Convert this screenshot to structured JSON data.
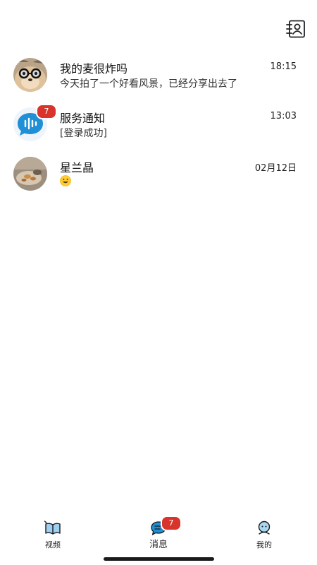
{
  "header": {
    "contacts_icon": "contacts-book-icon"
  },
  "conversations": [
    {
      "name": "我的麦很炸吗",
      "time": "18:15",
      "preview": "今天拍了一个好看风景，已经分享出去了",
      "avatar": "dog-with-glasses-photo"
    },
    {
      "name": "服务通知",
      "time": "13:03",
      "preview": "[登录成功]",
      "avatar": "service-voice-icon",
      "unread": "7"
    },
    {
      "name": "星兰晶",
      "time": "02月12日",
      "preview": "",
      "preview_icon": "grinning-emoji-icon",
      "avatar": "food-photo"
    }
  ],
  "tabbar": {
    "tabs": [
      {
        "label": "视频",
        "icon": "video-book-icon"
      },
      {
        "label": "消息",
        "icon": "message-bubble-icon",
        "badge": "7",
        "active": true
      },
      {
        "label": "我的",
        "icon": "profile-face-icon"
      }
    ]
  },
  "colors": {
    "badge": "#d8342c",
    "accent": "#1f8fd6",
    "background": "#ffffff"
  }
}
